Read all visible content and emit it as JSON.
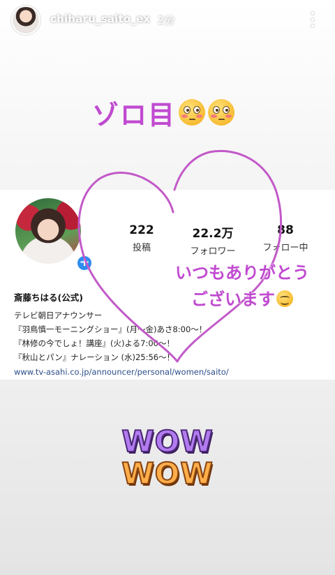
{
  "story": {
    "username": "chiharu_saito_ex",
    "time_ago": "2分",
    "more_icon": "more-vertical-icon"
  },
  "stickers": {
    "headline": "ゾロ目",
    "headline_emoji": "flushed-face",
    "message_line1": "いつもありがとう",
    "message_line2": "ございます",
    "message_emoji": "smiling-face",
    "wow_line1": "WOW",
    "wow_line2": "WOW"
  },
  "profile": {
    "add_icon": "plus-icon",
    "stats": {
      "posts_count": "222",
      "posts_label": "投稿",
      "followers_count": "22.2万",
      "followers_label": "フォロワー",
      "following_count": "88",
      "following_label": "フォロー中"
    },
    "bio": {
      "name": "斎藤ちはる(公式)",
      "line1": "テレビ朝日アナウンサー",
      "line2": "『羽鳥慎一モーニングショー』(月〜金)あさ8:00〜！",
      "line3": "『林修の今でしょ！講座』(火)よる7:00〜！",
      "line4": "『秋山とパン』ナレーション (水)25:56〜！",
      "link": "www.tv-asahi.co.jp/announcer/personal/women/saito/"
    }
  },
  "colors": {
    "accent_purple": "#c04ad0",
    "heart_stroke": "#c259c8",
    "link_blue": "#2c4e8a",
    "badge_blue": "#2f8cf1"
  }
}
